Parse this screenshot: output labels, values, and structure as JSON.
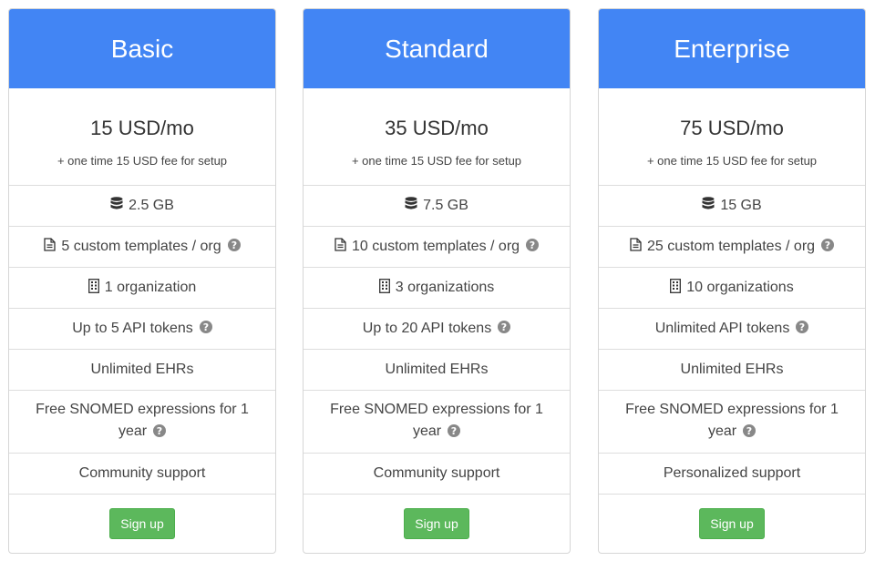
{
  "colors": {
    "header": "#4285f4",
    "signup_button": "#5cb85c",
    "border": "#d6d6d6"
  },
  "plans": [
    {
      "name": "Basic",
      "price": "15 USD/mo",
      "setup_fee": "+ one time 15 USD fee for setup",
      "storage": "2.5 GB",
      "templates": "5 custom templates / org",
      "organizations": "1 organization",
      "api_tokens": "Up to 5 API tokens",
      "ehrs": "Unlimited EHRs",
      "snomed": "Free SNOMED expressions for 1 year",
      "support": "Community support",
      "signup_label": "Sign up"
    },
    {
      "name": "Standard",
      "price": "35 USD/mo",
      "setup_fee": "+ one time 15 USD fee for setup",
      "storage": "7.5 GB",
      "templates": "10 custom templates / org",
      "organizations": "3 organizations",
      "api_tokens": "Up to 20 API tokens",
      "ehrs": "Unlimited EHRs",
      "snomed": "Free SNOMED expressions for 1 year",
      "support": "Community support",
      "signup_label": "Sign up"
    },
    {
      "name": "Enterprise",
      "price": "75 USD/mo",
      "setup_fee": "+ one time 15 USD fee for setup",
      "storage": "15 GB",
      "templates": "25 custom templates / org",
      "organizations": "10 organizations",
      "api_tokens": "Unlimited API tokens",
      "ehrs": "Unlimited EHRs",
      "snomed": "Free SNOMED expressions for 1 year",
      "support": "Personalized support",
      "signup_label": "Sign up"
    }
  ],
  "icons": {
    "storage": "database-icon",
    "templates": "file-text-icon",
    "organizations": "building-icon",
    "help": "question-circle-icon"
  }
}
